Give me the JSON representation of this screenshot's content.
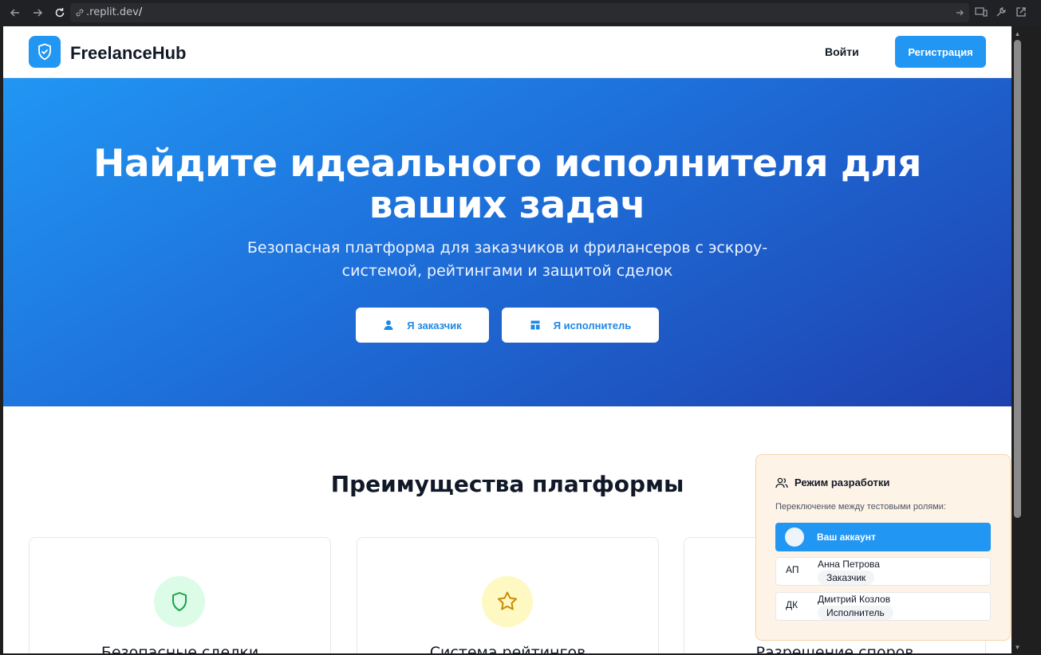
{
  "browser": {
    "url_prefix": ".replit.dev",
    "url_suffix": "/"
  },
  "header": {
    "brand": "FreelanceHub",
    "login_label": "Войти",
    "register_label": "Регистрация"
  },
  "hero": {
    "title": "Найдите идеального исполнителя для ваших задач",
    "subtitle": "Безопасная платформа для заказчиков и фрилансеров с эскроу-системой, рейтингами и защитой сделок",
    "client_button": "Я заказчик",
    "freelancer_button": "Я исполнитель"
  },
  "features": {
    "title": "Преимущества платформы",
    "cards": [
      {
        "title": "Безопасные сделки",
        "icon": "shield-icon",
        "color": "#16a34a",
        "bg": "#dcfce7"
      },
      {
        "title": "Система рейтингов",
        "icon": "star-icon",
        "color": "#ca8a04",
        "bg": "#fef9c3"
      },
      {
        "title": "Разрешение споров",
        "icon": "scale-icon"
      }
    ]
  },
  "dev_panel": {
    "title": "Режим разработки",
    "subtitle": "Переключение между тестовыми ролями:",
    "accounts": [
      {
        "name": "Ваш аккаунт",
        "active": true
      },
      {
        "initials": "АП",
        "name": "Анна Петрова",
        "role": "Заказчик"
      },
      {
        "initials": "ДК",
        "name": "Дмитрий Козлов",
        "role": "Исполнитель"
      }
    ]
  },
  "colors": {
    "primary": "#2196f3",
    "hero_gradient_start": "#2196f3",
    "hero_gradient_end": "#1e40af",
    "dev_panel_bg": "#fef3e7"
  }
}
